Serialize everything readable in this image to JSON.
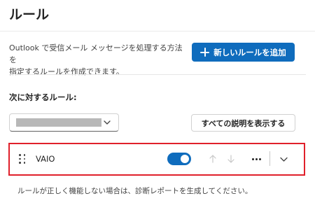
{
  "header": {
    "title": "ルール"
  },
  "intro": {
    "line1": "Outlook で受信メール メッセージを処理する方法を",
    "line2": "指定するルールを作成できます。"
  },
  "toolbar": {
    "new_rule_label": "新しいルールを追加",
    "new_rule_icon": "plus-icon"
  },
  "filter": {
    "label": "次に対するルール:",
    "selected_value": "",
    "show_all_label": "すべての説明を表示する"
  },
  "rules": [
    {
      "name": "VAIO",
      "enabled": true,
      "icons": [
        "drag-handle-icon",
        "arrow-up-icon",
        "arrow-down-icon",
        "more-icon",
        "chevron-down-icon"
      ]
    }
  ],
  "footer": {
    "note": "ルールが正しく機能しない場合は、診断レポートを生成してください。"
  },
  "colors": {
    "accent": "#0f6cbd",
    "highlight_border": "#e0202b",
    "disabled_icon": "#c8c8c8"
  }
}
